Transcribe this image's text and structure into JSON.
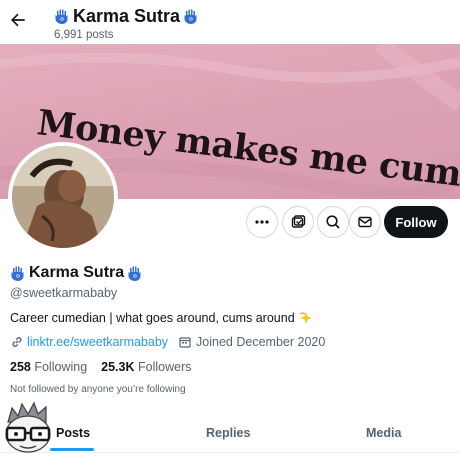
{
  "header": {
    "name": "Karma Sutra",
    "posts_count": "6,991 posts"
  },
  "banner": {
    "text": "Money makes me cum"
  },
  "actions": {
    "follow_label": "Follow"
  },
  "profile": {
    "name": "Karma Sutra",
    "handle": "@sweetkarmababy",
    "bio": "Career cumedian | what goes around, cums around",
    "link": "linktr.ee/sweetkarmababy",
    "joined": "Joined December 2020",
    "following_count": "258",
    "following_label": "Following",
    "followers_count": "25.3K",
    "followers_label": "Followers",
    "not_followed": "Not followed by anyone you’re following"
  },
  "tabs": [
    {
      "label": "Posts",
      "active": true
    },
    {
      "label": "Replies",
      "active": false
    },
    {
      "label": "Media",
      "active": false
    }
  ],
  "colors": {
    "accent": "#1d9bf0",
    "follow_button": "#0f1419",
    "banner": "#dda3b4",
    "hamsa": "#2f6fd6"
  }
}
